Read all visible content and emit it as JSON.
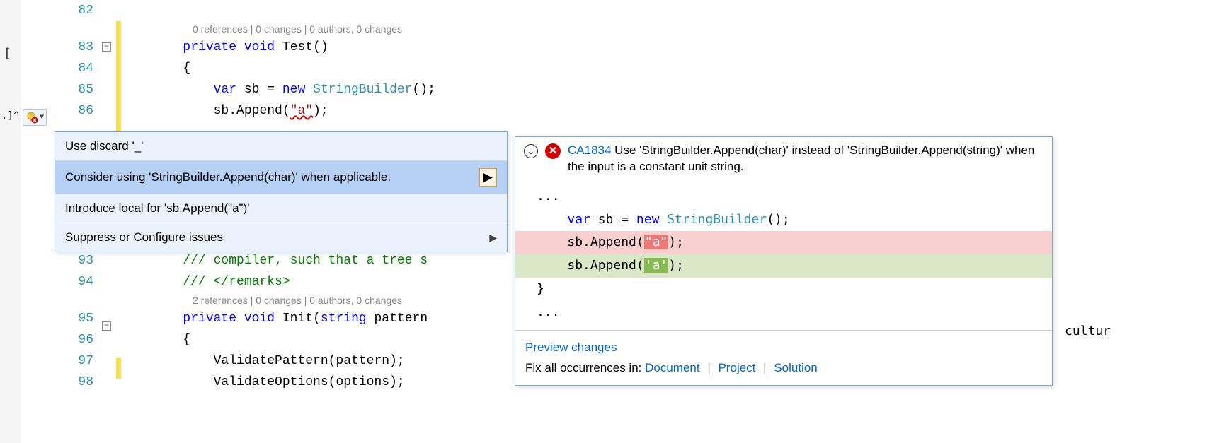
{
  "gutter": {
    "lines": [
      "82",
      "83",
      "84",
      "85",
      "86",
      "93",
      "94",
      "95",
      "96",
      "97",
      "98"
    ]
  },
  "codelens": {
    "test": "0 references | 0 changes | 0 authors, 0 changes",
    "init": "2 references | 0 changes | 0 authors, 0 changes"
  },
  "code": {
    "l82": "",
    "l83_kw1": "private",
    "l83_kw2": "void",
    "l83_name": " Test()",
    "l84": "{",
    "l85_kw1": "var",
    "l85_mid": " sb = ",
    "l85_kw2": "new",
    "l85_type": " StringBuilder",
    "l85_end": "();",
    "l86_pre": "    sb.Append(",
    "l86_str": "\"a\"",
    "l86_end": ");",
    "l93_com": "/// compiler, such that a tree s",
    "l94_com": "/// </remarks>",
    "l95_kw1": "private",
    "l95_kw2": "void",
    "l95_name": " Init(",
    "l95_kw3": "string",
    "l95_end": " pattern",
    "l96": "{",
    "l97": "    ValidatePattern(pattern);",
    "l98": "    ValidateOptions(options);"
  },
  "margin": {
    "annotation": ".]^",
    "bracket": "["
  },
  "quick_actions": {
    "items": [
      "Use discard '_'",
      "Consider using 'StringBuilder.Append(char)' when applicable.",
      "Introduce local for 'sb.Append(\"a\")'",
      "Suppress or Configure issues"
    ]
  },
  "preview": {
    "rule": "CA1834",
    "message": "Use 'StringBuilder.Append(char)' instead of 'StringBuilder.Append(string)' when the input is a constant unit string.",
    "ellipsis": "...",
    "line_var_kw1": "var",
    "line_var_mid": " sb = ",
    "line_var_kw2": "new",
    "line_var_type": " StringBuilder",
    "line_var_end": "();",
    "del_pre": "sb.Append(",
    "del_hl": "\"a\"",
    "del_post": ");",
    "add_pre": "sb.Append(",
    "add_hl": "'a'",
    "add_post": ");",
    "brace": "}",
    "footer_preview": "Preview changes",
    "footer_fix_label": "Fix all occurrences in: ",
    "footer_doc": "Document",
    "footer_proj": "Project",
    "footer_sol": "Solution"
  },
  "right_snippet": "cultur"
}
